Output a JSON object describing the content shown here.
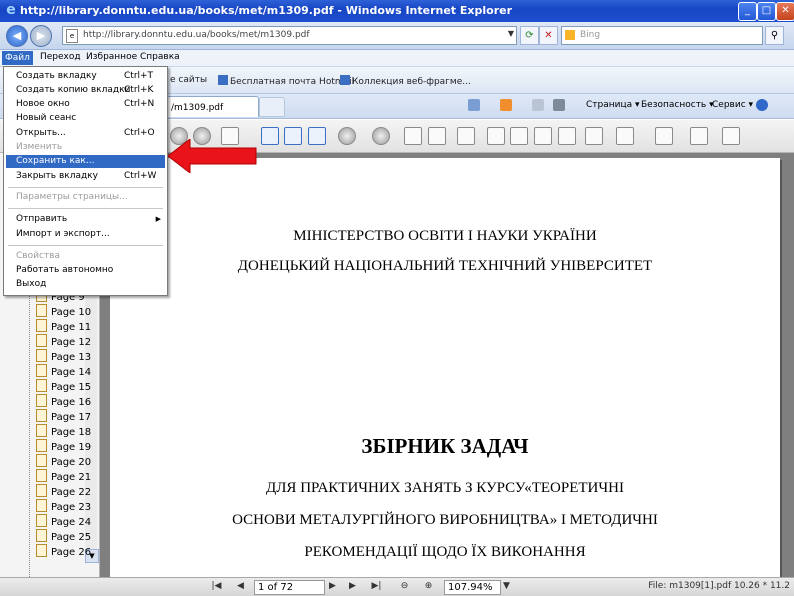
{
  "window": {
    "title": "http://library.donntu.edu.ua/books/met/m1309.pdf - Windows Internet Explorer",
    "minimize": "_",
    "maximize": "□",
    "close": "✕"
  },
  "address": {
    "url": "http://library.donntu.edu.ua/books/met/m1309.pdf",
    "search_placeholder": "Bing"
  },
  "menubar": {
    "items": [
      "Файл",
      "Переход",
      "Избранное",
      "Справка"
    ]
  },
  "favorites": {
    "items": [
      "е сайты",
      "Бесплатная почта Hotmail",
      "Коллекция веб-фрагме..."
    ]
  },
  "tab": {
    "label": "/m1309.pdf"
  },
  "command_bar": {
    "page": "Страница",
    "safety": "Безопасность",
    "tools": "Сервис"
  },
  "file_menu": {
    "items": [
      {
        "label": "Создать вкладку",
        "shortcut": "Ctrl+T",
        "state": "normal"
      },
      {
        "label": "Создать копию вкладки",
        "shortcut": "Ctrl+K",
        "state": "normal"
      },
      {
        "label": "Новое окно",
        "shortcut": "Ctrl+N",
        "state": "normal"
      },
      {
        "label": "Новый сеанс",
        "shortcut": "",
        "state": "normal"
      },
      {
        "label": "Открыть...",
        "shortcut": "Ctrl+O",
        "state": "normal"
      },
      {
        "label": "Изменить",
        "shortcut": "",
        "state": "disabled"
      },
      {
        "label": "Сохранить как...",
        "shortcut": "",
        "state": "highlighted"
      },
      {
        "label": "Закрыть вкладку",
        "shortcut": "Ctrl+W",
        "state": "normal"
      },
      {
        "label": "Параметры страницы...",
        "shortcut": "",
        "state": "disabled"
      },
      {
        "label": "Отправить",
        "shortcut": "",
        "state": "submenu"
      },
      {
        "label": "Импорт и экспорт...",
        "shortcut": "",
        "state": "normal"
      },
      {
        "label": "Свойства",
        "shortcut": "",
        "state": "disabled"
      },
      {
        "label": "Работать автономно",
        "shortcut": "",
        "state": "normal"
      },
      {
        "label": "Выход",
        "shortcut": "",
        "state": "normal"
      }
    ]
  },
  "sidebar": {
    "pages": [
      "Page 9",
      "Page 10",
      "Page 11",
      "Page 12",
      "Page 13",
      "Page 14",
      "Page 15",
      "Page 16",
      "Page 17",
      "Page 18",
      "Page 19",
      "Page 20",
      "Page 21",
      "Page 22",
      "Page 23",
      "Page 24",
      "Page 25",
      "Page 26"
    ]
  },
  "document": {
    "line1": "МІНІСТЕРСТВО ОСВІТИ І НАУКИ УКРАЇНИ",
    "line2": "ДОНЕЦЬКИЙ НАЦІОНАЛЬНИЙ ТЕХНІЧНИЙ УНІВЕРСИТЕТ",
    "title": "ЗБІРНИК ЗАДАЧ",
    "sub1": "ДЛЯ ПРАКТИЧНИХ ЗАНЯТЬ З КУРСУ«ТЕОРЕТИЧНІ",
    "sub2": "ОСНОВИ МЕТАЛУРГІЙНОГО ВИРОБНИЦТВА» І МЕТОДИЧНІ",
    "sub3": "РЕКОМЕНДАЦІЇ ЩОДО ЇХ ВИКОНАННЯ"
  },
  "status": {
    "page_indicator": "1 of 72",
    "zoom": "107.94%",
    "filename": "File: m1309[1].pdf 10.26 * 11.2"
  },
  "colors": {
    "titlebar": "#1c4fd0",
    "highlight": "#316ac5",
    "arrow": "#e8141a"
  }
}
